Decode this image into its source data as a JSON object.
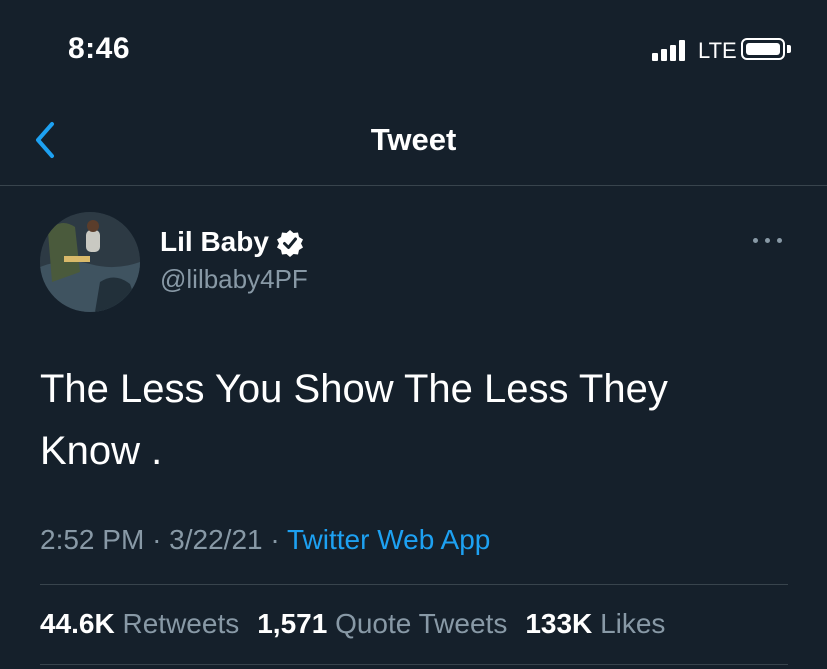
{
  "status_bar": {
    "time": "8:46",
    "network": "LTE",
    "signal_icon": "cellular-signal-icon",
    "battery_icon": "battery-icon"
  },
  "nav": {
    "title": "Tweet",
    "back_icon": "chevron-left-icon"
  },
  "tweet": {
    "author": {
      "display_name": "Lil Baby",
      "handle": "@lilbaby4PF",
      "verified": true
    },
    "text_line1": "The Less You Show The Less They",
    "text_line2": "Know .",
    "time": "2:52 PM",
    "date": "3/22/21",
    "separator": "·",
    "source": "Twitter Web App"
  },
  "stats": {
    "retweets_count": "44.6K",
    "retweets_label": "Retweets",
    "quotes_count": "1,571",
    "quotes_label": "Quote Tweets",
    "likes_count": "133K",
    "likes_label": "Likes"
  },
  "colors": {
    "background": "#15202b",
    "accent": "#1da1f2",
    "secondary_text": "#8899a6",
    "divider": "#38444d"
  }
}
